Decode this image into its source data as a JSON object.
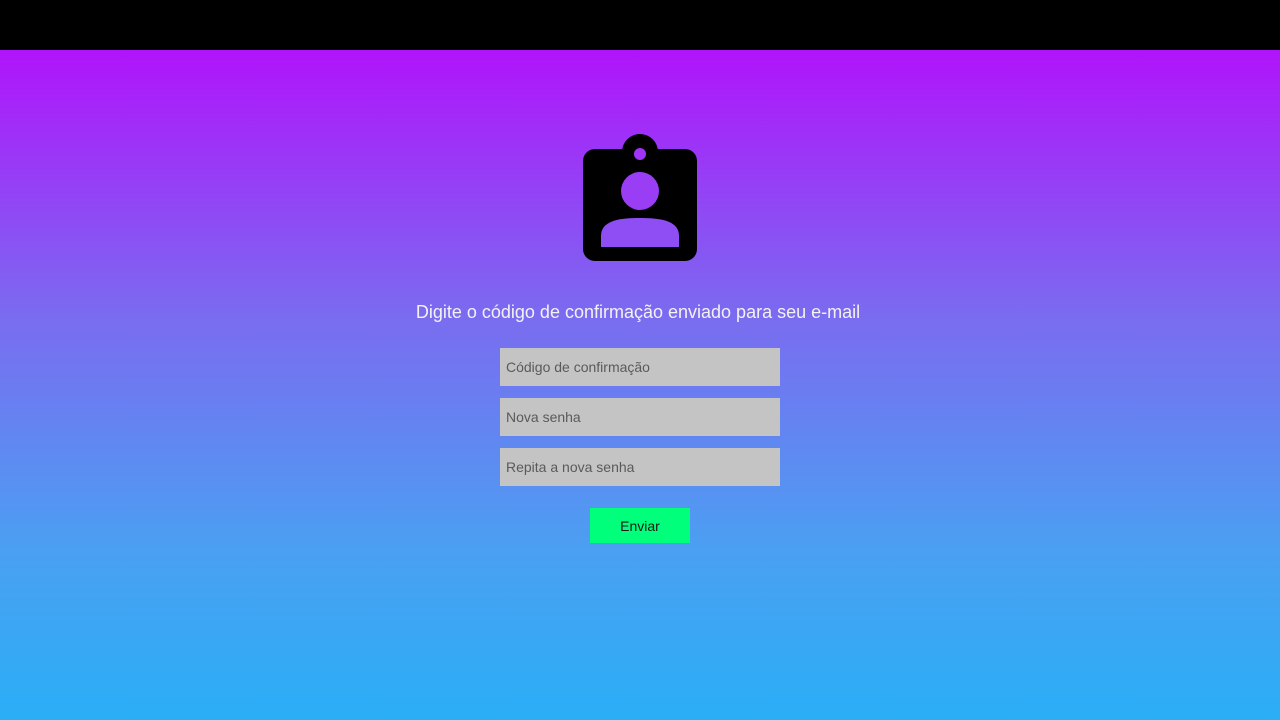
{
  "header": {
    "background": "#000000"
  },
  "theme": {
    "gradient_top": "#b014fb",
    "gradient_bottom": "#2aaef6",
    "input_background": "#c4c4c4",
    "button_background": "#00ff7a"
  },
  "form": {
    "icon": "badge-person-icon",
    "message": "Digite o código de confirmação enviado para seu e-mail",
    "fields": {
      "code": {
        "value": "",
        "placeholder": "Código de confirmação"
      },
      "new_password": {
        "value": "",
        "placeholder": "Nova senha"
      },
      "repeat_password": {
        "value": "",
        "placeholder": "Repita a nova senha"
      }
    },
    "submit_label": "Enviar"
  }
}
